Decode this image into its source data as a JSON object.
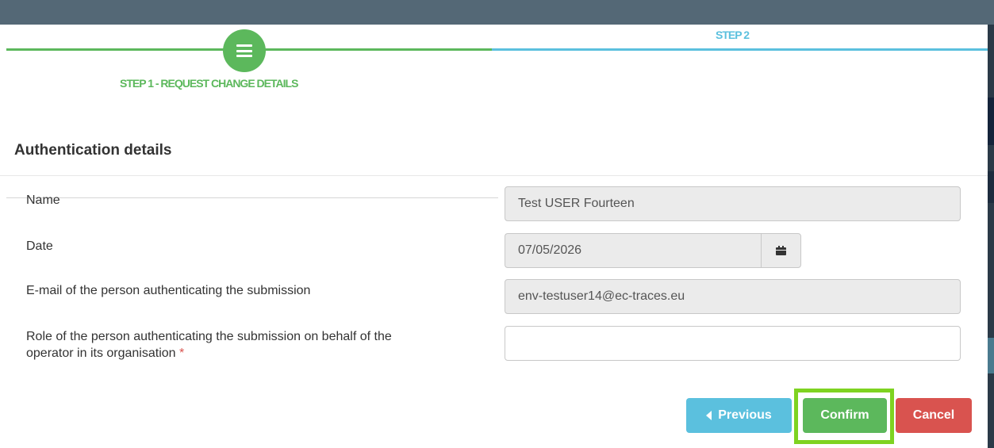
{
  "wizard": {
    "step1_label": "STEP 1 - REQUEST CHANGE DETAILS",
    "step2_label": "STEP 2",
    "step1_icon": "hamburger-menu-icon",
    "completed_color": "#5cb85c",
    "pending_color": "#5bc0de"
  },
  "section": {
    "title": "Authentication details"
  },
  "fields": {
    "name": {
      "label": "Name",
      "value": "Test USER Fourteen"
    },
    "date": {
      "label": "Date",
      "value": "07/05/2026",
      "icon": "calendar-icon"
    },
    "email": {
      "label": "E-mail of the person authenticating the submission",
      "value": "env-testuser14@ec-traces.eu"
    },
    "role": {
      "label_line1": "Role of the person authenticating the submission on behalf of the",
      "label_line2": "operator in its organisation",
      "required_marker": "*",
      "value": ""
    }
  },
  "buttons": {
    "previous": "Previous",
    "confirm": "Confirm",
    "cancel": "Cancel",
    "previous_icon": "caret-left-icon",
    "highlight_color": "#7ed321"
  }
}
